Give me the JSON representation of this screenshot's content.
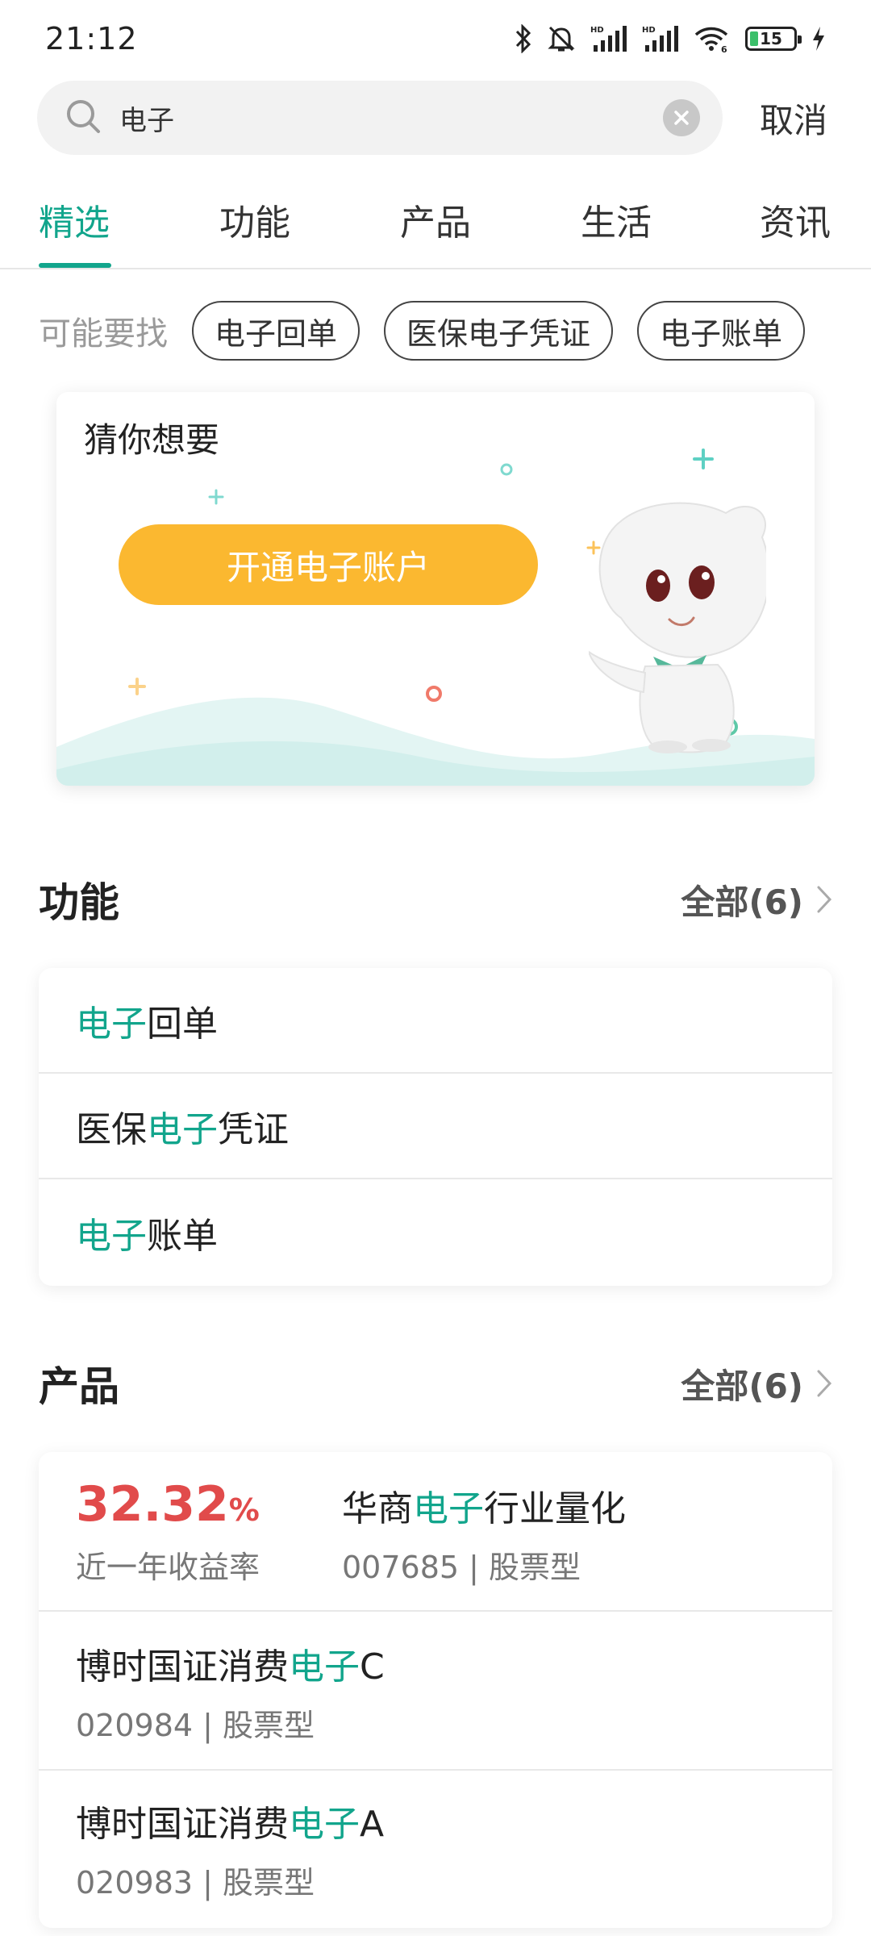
{
  "status_bar": {
    "time": "21:12",
    "battery": "15",
    "icons": [
      "bluetooth-icon",
      "bell-muted-icon",
      "signal-hd-icon",
      "signal-hd-icon",
      "wifi-icon",
      "battery-icon",
      "charging-icon"
    ]
  },
  "search": {
    "value": "电子",
    "placeholder": "",
    "cancel_label": "取消"
  },
  "tabs": [
    {
      "label": "精选",
      "active": true
    },
    {
      "label": "功能",
      "active": false
    },
    {
      "label": "产品",
      "active": false
    },
    {
      "label": "生活",
      "active": false
    },
    {
      "label": "资讯",
      "active": false
    }
  ],
  "suggestions": {
    "label": "可能要找",
    "chips": [
      "电子回单",
      "医保电子凭证",
      "电子账单"
    ]
  },
  "guess": {
    "title": "猜你想要",
    "button_label": "开通电子账户"
  },
  "functions_section": {
    "title": "功能",
    "all_label": "全部(6)",
    "items": [
      {
        "pre": "",
        "hl": "电子",
        "post": "回单"
      },
      {
        "pre": "医保",
        "hl": "电子",
        "post": "凭证"
      },
      {
        "pre": "",
        "hl": "电子",
        "post": "账单"
      }
    ]
  },
  "products_section": {
    "title": "产品",
    "all_label": "全部(6)",
    "items": [
      {
        "rate": "32.32",
        "rate_unit": "%",
        "rate_label": "近一年收益率",
        "pre": "华商",
        "hl": "电子",
        "post": "行业量化",
        "meta": "007685 | 股票型"
      },
      {
        "pre": "博时国证消费",
        "hl": "电子",
        "post": "C",
        "meta": "020984 | 股票型"
      },
      {
        "pre": "博时国证消费",
        "hl": "电子",
        "post": "A",
        "meta": "020983 | 股票型"
      }
    ]
  },
  "colors": {
    "accent": "#12a58c",
    "button": "#fbb830",
    "rate": "#e14b4b"
  }
}
